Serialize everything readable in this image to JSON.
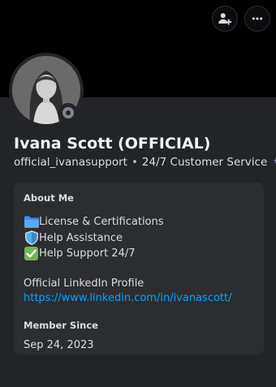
{
  "profile": {
    "display_name": "Ivana Scott (OFFICIAL)",
    "username": "official_ivanasupport",
    "separator": "•",
    "pronouns_tagline": "24/7 Customer Service",
    "status": "offline"
  },
  "header": {
    "add_friend_icon": "person-add-icon",
    "more_icon": "more-options-icon"
  },
  "about": {
    "title": "About Me",
    "items": [
      {
        "icon": "folder-icon",
        "label": "License & Certifications"
      },
      {
        "icon": "shield-icon",
        "label": "Help Assistance"
      },
      {
        "icon": "check-mark-icon",
        "label": "Help Support 24/7"
      }
    ],
    "linkedin_label": "Official LinkedIn Profile",
    "linkedin_url": "https://www.linkedin.com/in/ivanascott/"
  },
  "member_since": {
    "title": "Member Since",
    "date": "Sep 24, 2023"
  },
  "colors": {
    "banner": "#000000",
    "panel": "#232428",
    "card": "#2b2d31",
    "link": "#00a8fc",
    "status_offline": "#80848e"
  }
}
